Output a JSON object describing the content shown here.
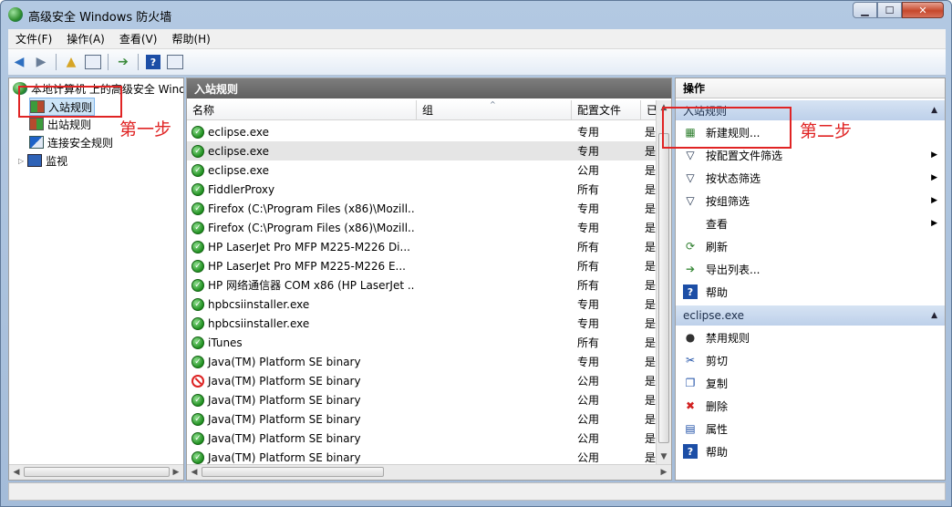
{
  "window": {
    "title": "高级安全 Windows 防火墙"
  },
  "menu": [
    "文件(F)",
    "操作(A)",
    "查看(V)",
    "帮助(H)"
  ],
  "tree": {
    "root": "本地计算机 上的高级安全 Windows",
    "items": [
      {
        "label": "入站规则"
      },
      {
        "label": "出站规则"
      },
      {
        "label": "连接安全规则"
      },
      {
        "label": "监视"
      }
    ]
  },
  "center": {
    "header": "入站规则",
    "columns": [
      "名称",
      "组",
      "配置文件",
      "已"
    ],
    "rows": [
      {
        "name": "eclipse.exe",
        "profile": "专用",
        "enabled": "是",
        "status": "allow"
      },
      {
        "name": "eclipse.exe",
        "profile": "专用",
        "enabled": "是",
        "status": "allow"
      },
      {
        "name": "eclipse.exe",
        "profile": "公用",
        "enabled": "是",
        "status": "allow"
      },
      {
        "name": "FiddlerProxy",
        "profile": "所有",
        "enabled": "是",
        "status": "allow"
      },
      {
        "name": "Firefox (C:\\Program Files (x86)\\Mozill...",
        "profile": "专用",
        "enabled": "是",
        "status": "allow"
      },
      {
        "name": "Firefox (C:\\Program Files (x86)\\Mozill...",
        "profile": "专用",
        "enabled": "是",
        "status": "allow"
      },
      {
        "name": "HP LaserJet Pro MFP M225-M226 Di...",
        "profile": "所有",
        "enabled": "是",
        "status": "allow"
      },
      {
        "name": "HP LaserJet Pro MFP M225-M226 E...",
        "profile": "所有",
        "enabled": "是",
        "status": "allow"
      },
      {
        "name": "HP 网络通信器 COM x86 (HP LaserJet ...",
        "profile": "所有",
        "enabled": "是",
        "status": "allow"
      },
      {
        "name": "hpbcsiinstaller.exe",
        "profile": "专用",
        "enabled": "是",
        "status": "allow"
      },
      {
        "name": "hpbcsiinstaller.exe",
        "profile": "专用",
        "enabled": "是",
        "status": "allow"
      },
      {
        "name": "iTunes",
        "profile": "所有",
        "enabled": "是",
        "status": "allow"
      },
      {
        "name": "Java(TM) Platform SE binary",
        "profile": "专用",
        "enabled": "是",
        "status": "allow"
      },
      {
        "name": "Java(TM) Platform SE binary",
        "profile": "公用",
        "enabled": "是",
        "status": "block"
      },
      {
        "name": "Java(TM) Platform SE binary",
        "profile": "公用",
        "enabled": "是",
        "status": "allow"
      },
      {
        "name": "Java(TM) Platform SE binary",
        "profile": "公用",
        "enabled": "是",
        "status": "allow"
      },
      {
        "name": "Java(TM) Platform SE binary",
        "profile": "公用",
        "enabled": "是",
        "status": "allow"
      },
      {
        "name": "Java(TM) Platform SE binary",
        "profile": "公用",
        "enabled": "是",
        "status": "allow"
      }
    ]
  },
  "actions": {
    "title": "操作",
    "section1": {
      "title": "入站规则",
      "items": [
        {
          "label": "新建规则...",
          "icon": "new-rule-icon"
        },
        {
          "label": "按配置文件筛选",
          "icon": "filter-icon",
          "submenu": true
        },
        {
          "label": "按状态筛选",
          "icon": "filter-icon",
          "submenu": true
        },
        {
          "label": "按组筛选",
          "icon": "filter-icon",
          "submenu": true
        },
        {
          "label": "查看",
          "icon": "",
          "submenu": true
        },
        {
          "label": "刷新",
          "icon": "refresh-icon"
        },
        {
          "label": "导出列表...",
          "icon": "export-icon"
        },
        {
          "label": "帮助",
          "icon": "help-icon"
        }
      ]
    },
    "section2": {
      "title": "eclipse.exe",
      "items": [
        {
          "label": "禁用规则",
          "icon": "disable-icon"
        },
        {
          "label": "剪切",
          "icon": "cut-icon"
        },
        {
          "label": "复制",
          "icon": "copy-icon"
        },
        {
          "label": "删除",
          "icon": "delete-icon"
        },
        {
          "label": "属性",
          "icon": "properties-icon"
        },
        {
          "label": "帮助",
          "icon": "help-icon"
        }
      ]
    }
  },
  "annotations": {
    "step1": "第一步",
    "step2": "第二步"
  },
  "colors": {
    "annotation": "#e02424",
    "section": "#bdd0ea",
    "header": "#606060"
  }
}
